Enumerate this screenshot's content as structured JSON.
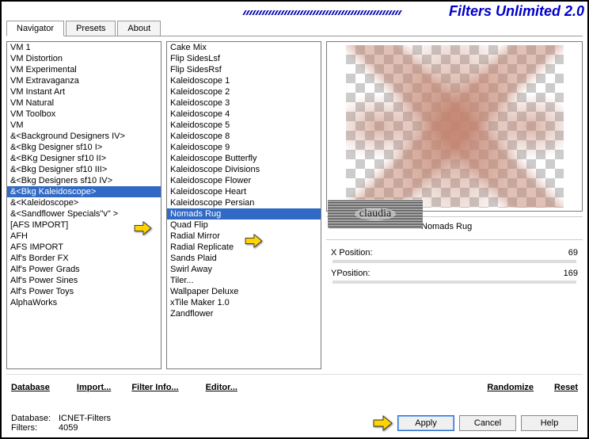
{
  "title": "Filters Unlimited 2.0",
  "tabs": {
    "navigator": "Navigator",
    "presets": "Presets",
    "about": "About"
  },
  "leftList": [
    "VM 1",
    "VM Distortion",
    "VM Experimental",
    "VM Extravaganza",
    "VM Instant Art",
    "VM Natural",
    "VM Toolbox",
    "VM",
    "&<Background Designers IV>",
    "&<Bkg Designer sf10 I>",
    "&<BKg Designer sf10 II>",
    "&<Bkg Designer sf10 III>",
    "&<Bkg Designers sf10 IV>",
    "&<Bkg Kaleidoscope>",
    "&<Kaleidoscope>",
    "&<Sandflower Specials\"v\" >",
    "[AFS IMPORT]",
    "AFH",
    "AFS IMPORT",
    "Alf's Border FX",
    "Alf's Power Grads",
    "Alf's Power Sines",
    "Alf's Power Toys",
    "AlphaWorks"
  ],
  "leftSelectedIndex": 13,
  "midList": [
    "Cake Mix",
    "Flip SidesLsf",
    "Flip SidesRsf",
    "Kaleidoscope 1",
    "Kaleidoscope 2",
    "Kaleidoscope 3",
    "Kaleidoscope 4",
    "Kaleidoscope 5",
    "Kaleidoscope 8",
    "Kaleidoscope 9",
    "Kaleidoscope Butterfly",
    "Kaleidoscope Divisions",
    "Kaleidoscope Flower",
    "Kaleidoscope Heart",
    "Kaleidoscope Persian",
    "Nomads Rug",
    "Quad Flip",
    "Radial Mirror",
    "Radial Replicate",
    "Sands Plaid",
    "Swirl Away",
    "Tiler...",
    "Wallpaper Deluxe",
    "xTile Maker 1.0",
    "Zandflower"
  ],
  "midSelectedIndex": 15,
  "preview": {
    "filterName": "Nomads Rug"
  },
  "params": {
    "name1": "X Position:",
    "val1": "69",
    "name2": "YPosition:",
    "val2": "169"
  },
  "links": {
    "database": "Database",
    "import": "Import...",
    "filterInfo": "Filter Info...",
    "editor": "Editor...",
    "randomize": "Randomize",
    "reset": "Reset"
  },
  "buttons": {
    "apply": "Apply",
    "cancel": "Cancel",
    "help": "Help"
  },
  "footer": {
    "dbLabel": "Database:",
    "dbValue": "ICNET-Filters",
    "filtersLabel": "Filters:",
    "filtersValue": "4059"
  },
  "watermark": "claudia"
}
